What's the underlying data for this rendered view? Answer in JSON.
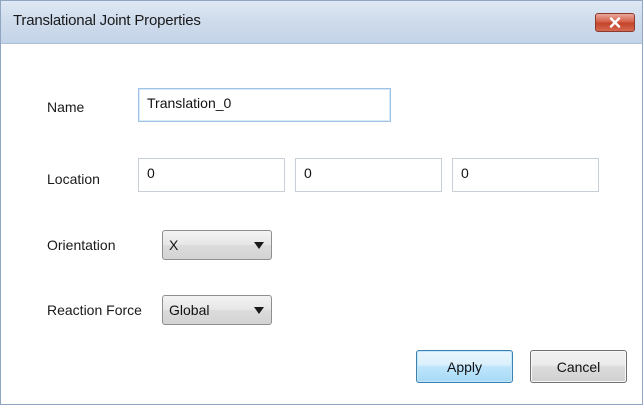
{
  "window": {
    "title": "Translational Joint Properties",
    "close_icon": "close-x-icon"
  },
  "form": {
    "name": {
      "label": "Name",
      "value": "Translation_0"
    },
    "location": {
      "label": "Location",
      "x": "0",
      "y": "0",
      "z": "0"
    },
    "orientation": {
      "label": "Orientation",
      "selected": "X"
    },
    "reaction_force": {
      "label": "Reaction Force",
      "selected": "Global"
    }
  },
  "buttons": {
    "apply": "Apply",
    "cancel": "Cancel"
  },
  "colors": {
    "titlebar": "#cfdcec",
    "close_button": "#c4432b",
    "apply_border": "#3c7fb1"
  }
}
